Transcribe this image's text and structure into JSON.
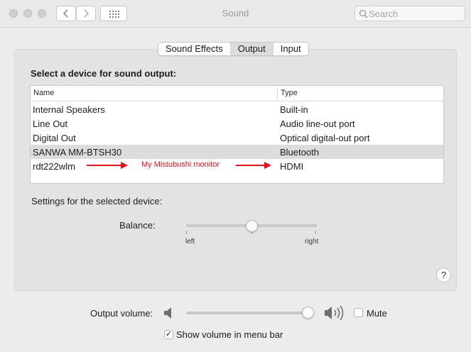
{
  "window": {
    "title": "Sound"
  },
  "toolbar": {
    "search_placeholder": "Search"
  },
  "tabs": [
    {
      "label": "Sound Effects",
      "selected": false
    },
    {
      "label": "Output",
      "selected": true
    },
    {
      "label": "Input",
      "selected": false
    }
  ],
  "output": {
    "heading": "Select a device for sound output:",
    "columns": {
      "name": "Name",
      "type": "Type"
    },
    "devices": [
      {
        "name": "Internal Speakers",
        "type": "Built-in"
      },
      {
        "name": "Line Out",
        "type": "Audio line-out port"
      },
      {
        "name": "Digital Out",
        "type": "Optical digital-out port"
      },
      {
        "name": "SANWA MM-BTSH30",
        "type": "Bluetooth"
      },
      {
        "name": "rdt222wlm",
        "type": "HDMI"
      }
    ],
    "selected_index": 3,
    "annotation": "My Mistubushi monitor",
    "annotation_color": "#e0151c"
  },
  "settings": {
    "label": "Settings for the selected device:",
    "balance_label": "Balance:",
    "balance_left": "left",
    "balance_right": "right",
    "balance_value": 0.5
  },
  "volume": {
    "label": "Output volume:",
    "level": 0.9,
    "mute_label": "Mute",
    "mute_checked": false,
    "show_in_menu_label": "Show volume in menu bar",
    "show_in_menu_checked": true
  },
  "help": {
    "label": "?"
  }
}
